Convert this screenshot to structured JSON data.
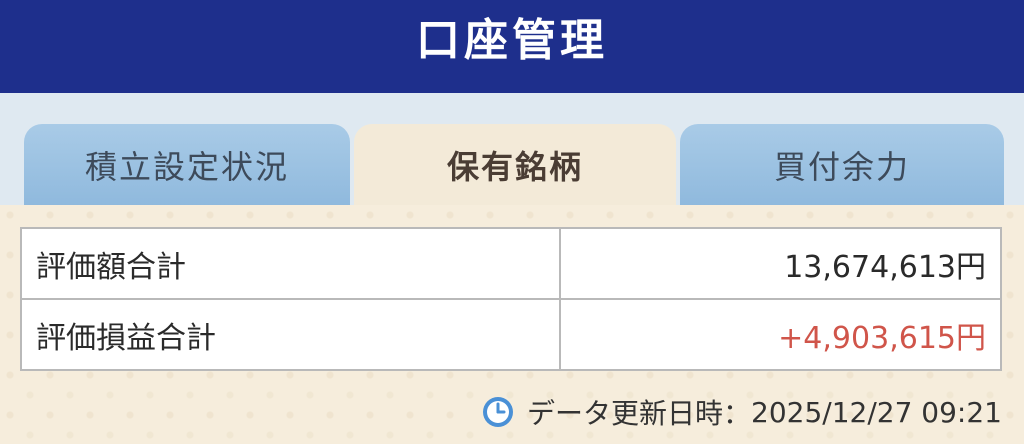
{
  "header": {
    "title": "口座管理"
  },
  "tabs": [
    {
      "label": "積立設定状況",
      "active": false
    },
    {
      "label": "保有銘柄",
      "active": true
    },
    {
      "label": "買付余力",
      "active": false
    }
  ],
  "summary": {
    "rows": [
      {
        "label": "評価額合計",
        "value": "13,674,613円"
      },
      {
        "label": "評価損益合計",
        "value": "+4,903,615円"
      }
    ]
  },
  "updated": {
    "label": "データ更新日時：",
    "datetime": "2025/12/27 09:21",
    "icon": "clock-icon"
  },
  "colors": {
    "header_bg": "#1e2f8c",
    "tab_inactive": "#a9cbe7",
    "tab_active": "#f3ead8",
    "gain": "#d0554a",
    "clock_icon": "#4a90d6"
  }
}
